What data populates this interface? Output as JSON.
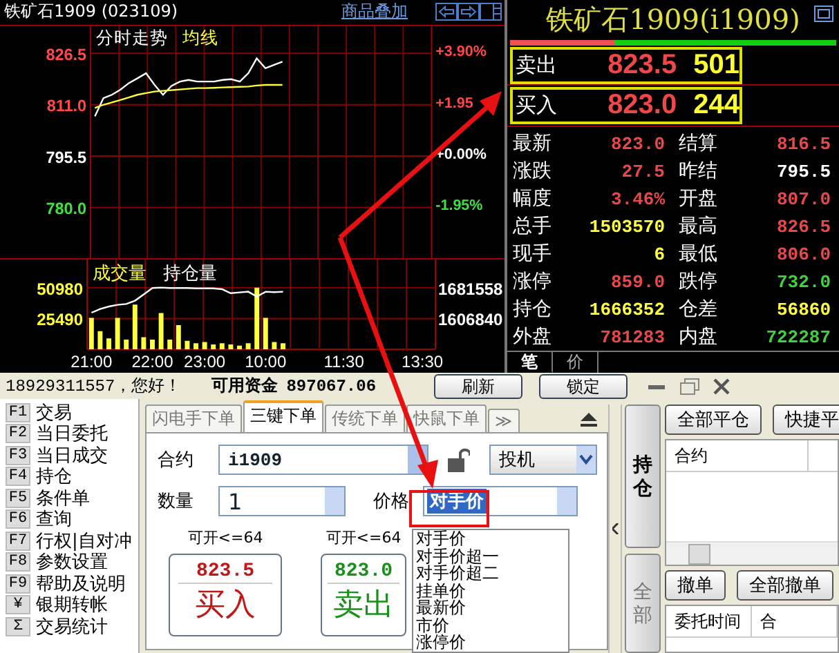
{
  "chart_panel": {
    "title": "铁矿石1909 (023109)",
    "overlay_link": "商品叠加",
    "price_chart": {
      "chart_data": {
        "type": "line",
        "grid": true,
        "categories": [
          null,
          null,
          null,
          null,
          null,
          null,
          null,
          null,
          null,
          null,
          null,
          null,
          null,
          null,
          null,
          null,
          null,
          null,
          null,
          null,
          null,
          null,
          null,
          null,
          null,
          null,
          null,
          null,
          null,
          null,
          null,
          null,
          null,
          null,
          null,
          null,
          null,
          null,
          null,
          null
        ],
        "series": [
          {
            "name": "分时走势",
            "color": "#ffffff",
            "values": [
              807.5,
              813,
              814,
              815.5,
              817.5,
              819,
              820.5,
              817,
              814,
              816.7,
              818,
              818.5,
              818,
              818,
              818,
              818.5,
              818.7,
              818,
              820.5,
              825,
              822,
              823,
              824,
              null,
              null,
              null,
              null,
              null,
              null,
              null,
              null,
              null,
              null,
              null,
              null,
              null,
              null,
              null,
              null,
              null
            ]
          },
          {
            "name": "均线",
            "color": "#ffff40",
            "values": [
              810,
              811,
              811.7,
              812.4,
              813.2,
              814,
              814.5,
              815,
              815.2,
              815.4,
              815.6,
              815.8,
              816,
              816,
              816.1,
              816.2,
              816.3,
              816.4,
              816.5,
              816.8,
              817,
              817,
              817,
              null,
              null,
              null,
              null,
              null,
              null,
              null,
              null,
              null,
              null,
              null,
              null,
              null,
              null,
              null,
              null,
              null
            ]
          }
        ],
        "ylim": [
          764.5,
          834.7
        ],
        "yticks": [
          {
            "value": 826.5,
            "label": "826.5"
          },
          {
            "value": 811,
            "label": "811.0"
          },
          {
            "value": 795.5,
            "label": "795.5"
          },
          {
            "value": 780,
            "label": "780.0"
          }
        ]
      },
      "right_labels": [
        {
          "text": "+3.90%",
          "color": "#ff4848"
        },
        {
          "text": "+1.95",
          "color": "#ff4848"
        },
        {
          "text": "+0.00%",
          "color": "#ffffff"
        },
        {
          "text": "-1.95%",
          "color": "#40e040"
        }
      ]
    },
    "volume_chart": {
      "chart_data": {
        "type": "bar",
        "grid": true,
        "categories": [
          "21:00",
          null,
          null,
          null,
          null,
          null,
          null,
          "22:00",
          null,
          null,
          null,
          null,
          null,
          "23:00",
          null,
          null,
          null,
          null,
          null,
          null,
          "10:00",
          null,
          null,
          null,
          null,
          null,
          null,
          null,
          null,
          "11:30",
          null,
          null,
          null,
          null,
          null,
          null,
          null,
          null,
          "13:30",
          null
        ],
        "series": [
          {
            "name": "成交量",
            "color": "#ffff40",
            "values": [
              26000,
              15000,
              9000,
              26000,
              8000,
              37000,
              10000,
              8000,
              30000,
              8000,
              20000,
              7000,
              5000,
              6000,
              4000,
              5000,
              4000,
              3000,
              5000,
              51000,
              26000,
              6000,
              5000,
              null,
              null,
              null,
              null,
              null,
              null,
              null,
              null,
              null,
              null,
              null,
              null,
              null,
              null,
              null,
              null,
              null
            ]
          }
        ],
        "ylim": [
          0,
          72000
        ],
        "yticks": [
          {
            "value": 50980,
            "label": "50980"
          },
          {
            "value": 25490,
            "label": "25490"
          }
        ]
      }
    },
    "open_interest_chart": {
      "chart_data": {
        "type": "line",
        "categories": [
          null,
          null,
          null,
          null,
          null,
          null,
          null,
          null,
          null,
          null,
          null,
          null,
          null,
          null,
          null,
          null,
          null,
          null,
          null,
          null,
          null,
          null,
          null,
          null,
          null,
          null,
          null,
          null,
          null,
          null,
          null,
          null,
          null,
          null,
          null,
          null,
          null,
          null,
          null,
          null
        ],
        "series": [
          {
            "name": "持仓量",
            "color": "#ffffff",
            "values": [
              1621000,
              1630000,
              1636000,
              1640000,
              1642000,
              1650000,
              1665000,
              1681000,
              1682000,
              1681000,
              1681000,
              1681000,
              1680000,
              1680000,
              1680000,
              1678000,
              1668000,
              1670000,
              1672000,
              1660000,
              1672000,
              1671000,
              1672000,
              null,
              null,
              null,
              null,
              null,
              null,
              null,
              null,
              null,
              null,
              null,
              null,
              null,
              null,
              null,
              null,
              null
            ]
          }
        ],
        "ylim": [
          1532120,
          1743210
        ],
        "yticks": [
          {
            "value": 1681558,
            "label": "1681558"
          },
          {
            "value": 1606840,
            "label": "1606840"
          }
        ]
      }
    }
  },
  "quote_panel": {
    "title": "铁矿石1909(i1909)",
    "buy_sell_ratio": {
      "level": 0.32
    },
    "book": [
      {
        "label": "卖出",
        "price": "823.5",
        "volume": "501"
      },
      {
        "label": "买入",
        "price": "823.0",
        "volume": "244"
      }
    ],
    "stats": [
      {
        "label": "最新",
        "value": "823.0",
        "color": "#e84848"
      },
      {
        "label": "结算",
        "value": "816.5",
        "color": "#e84848"
      },
      {
        "label": "涨跌",
        "value": "27.5",
        "color": "#e84848"
      },
      {
        "label": "昨结",
        "value": "795.5",
        "color": "#ffffff"
      },
      {
        "label": "幅度",
        "value": "3.46%",
        "color": "#e84848"
      },
      {
        "label": "开盘",
        "value": "807.0",
        "color": "#e84848"
      },
      {
        "label": "总手",
        "value": "1503570",
        "color": "#ffff40"
      },
      {
        "label": "最高",
        "value": "826.5",
        "color": "#e84848"
      },
      {
        "label": "现手",
        "value": "6",
        "color": "#ffff40"
      },
      {
        "label": "最低",
        "value": "806.0",
        "color": "#e84848"
      },
      {
        "label": "涨停",
        "value": "859.0",
        "color": "#e84848"
      },
      {
        "label": "跌停",
        "value": "732.0",
        "color": "#40d040"
      },
      {
        "label": "持仓",
        "value": "1666352",
        "color": "#ffff40"
      },
      {
        "label": "仓差",
        "value": "56860",
        "color": "#ffff40"
      },
      {
        "label": "外盘",
        "value": "781283",
        "color": "#e84848"
      },
      {
        "label": "内盘",
        "value": "722287",
        "color": "#40d040"
      }
    ],
    "tabs": [
      {
        "label": "笔",
        "selected": true
      },
      {
        "label": "价",
        "selected": false
      }
    ]
  },
  "trade_panel": {
    "greeting": "18929311557，您好！",
    "funds_label": "可用资金",
    "funds_value": "897067.06",
    "header_buttons": [
      "刷新",
      "锁定"
    ],
    "menu": [
      {
        "key": "F1",
        "label": "交易"
      },
      {
        "key": "F2",
        "label": "当日委托"
      },
      {
        "key": "F3",
        "label": "当日成交"
      },
      {
        "key": "F4",
        "label": "持仓"
      },
      {
        "key": "F5",
        "label": "条件单"
      },
      {
        "key": "F6",
        "label": "查询"
      },
      {
        "key": "F7",
        "label": "行权|自对冲"
      },
      {
        "key": "F8",
        "label": "参数设置"
      },
      {
        "key": "F9",
        "label": "帮助及说明"
      },
      {
        "key": "¥",
        "label": "银期转帐"
      },
      {
        "key": "Σ",
        "label": "交易统计"
      }
    ],
    "order_tabs": [
      {
        "label": "闪电手下单",
        "selected": false
      },
      {
        "label": "三键下单",
        "selected": true
      },
      {
        "label": "传统下单",
        "selected": false
      },
      {
        "label": "快鼠下单",
        "selected": false
      },
      {
        "label": "≫",
        "selected": false
      }
    ],
    "contract": {
      "label": "合约",
      "value": "i1909"
    },
    "hedge": {
      "value": "投机"
    },
    "quantity": {
      "label": "数量",
      "value": "1"
    },
    "price": {
      "label": "价格",
      "value": "对手价"
    },
    "price_options": [
      "对手价",
      "对手价超一",
      "对手价超二",
      "挂单价",
      "最新价",
      "市价",
      "涨停价"
    ],
    "order_buttons": [
      {
        "kind": "buy",
        "limit": "可开<=64",
        "price": "823.5",
        "label": "买入"
      },
      {
        "kind": "sell",
        "limit": "可开<=64",
        "price": "823.0",
        "label": "卖出"
      }
    ],
    "side_tabs": [
      {
        "label": "持仓",
        "disabled": false
      },
      {
        "label": "全部",
        "disabled": true
      }
    ],
    "position_buttons": [
      "全部平仓",
      "快捷平"
    ],
    "position_columns": [
      "合约"
    ],
    "order_buttons_2": [
      "撤单",
      "全部撤单"
    ],
    "order_columns": [
      "委托时间",
      "合"
    ]
  }
}
